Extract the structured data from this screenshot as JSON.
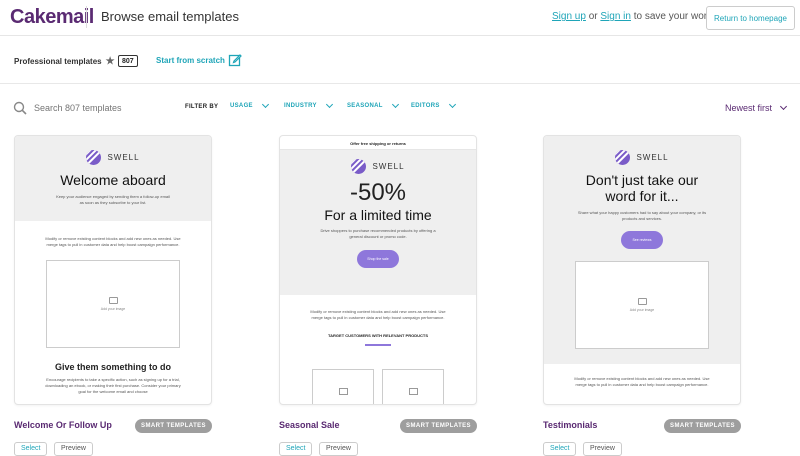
{
  "header": {
    "logo": "Cakemail",
    "title": "Browse email templates",
    "sign_up": "Sign up",
    "or": "or",
    "sign_in": "Sign in",
    "auth_suffix": "to save your work",
    "return_label": "Return to homepage"
  },
  "tabs": {
    "professional": "Professional templates",
    "count": "807",
    "scratch": "Start from scratch"
  },
  "toolbar": {
    "search_placeholder": "Search 807 templates",
    "filter_by": "FILTER BY",
    "filters": [
      "USAGE",
      "INDUSTRY",
      "SEASONAL",
      "EDITORS"
    ],
    "sort": "Newest first"
  },
  "cards": [
    {
      "title": "Welcome Or Follow Up",
      "badge": "SMART TEMPLATES",
      "select": "Select",
      "preview": "Preview",
      "brand": "SWELL",
      "heading": "Welcome aboard",
      "intro": "Keep your audience engaged by sending them a follow-up email as soon as they subscribe to your list.",
      "body": "Modify or remove existing content blocks and add new ones as needed. Use merge tags to pull in customer data and help boost campaign performance.",
      "image_label": "Add your image",
      "heading2": "Give them something to do",
      "body2": "Encourage recipients to take a specific action, such as signing up for a trial, downloading an ebook, or making their first purchase. Consider your primary goal for the welcome email and choose"
    },
    {
      "title": "Seasonal Sale",
      "badge": "SMART TEMPLATES",
      "select": "Select",
      "preview": "Preview",
      "banner": "Offer free shipping or returns",
      "brand": "SWELL",
      "heading": "-50%",
      "subheading": "For a limited time",
      "intro": "Drive shoppers to purchase recommended products by offering a general discount or promo code.",
      "cta": "Shop the sale",
      "body": "Modify or remove existing content blocks and add new ones as needed. Use merge tags to pull in customer data and help boost campaign performance.",
      "section": "TARGET CUSTOMERS WITH RELEVANT PRODUCTS"
    },
    {
      "title": "Testimonials",
      "badge": "SMART TEMPLATES",
      "select": "Select",
      "preview": "Preview",
      "brand": "SWELL",
      "heading": "Don't just take our word for it...",
      "intro": "Share what your happy customers had to say about your company, or its products and services.",
      "cta": "See reviews",
      "image_label": "Add your image",
      "body": "Modify or remove existing content blocks and add new ones as needed. Use merge tags to pull in customer data and help boost campaign performance."
    }
  ],
  "colors": {
    "brand_purple": "#5a2a72",
    "teal_link": "#1fa5b8",
    "cta_purple": "#8e77db",
    "badge_gray": "#9e9e9e"
  },
  "icons": [
    "star-icon",
    "edit-icon",
    "search-icon",
    "chevron-down-icon",
    "swell-logo-icon",
    "image-icon"
  ]
}
